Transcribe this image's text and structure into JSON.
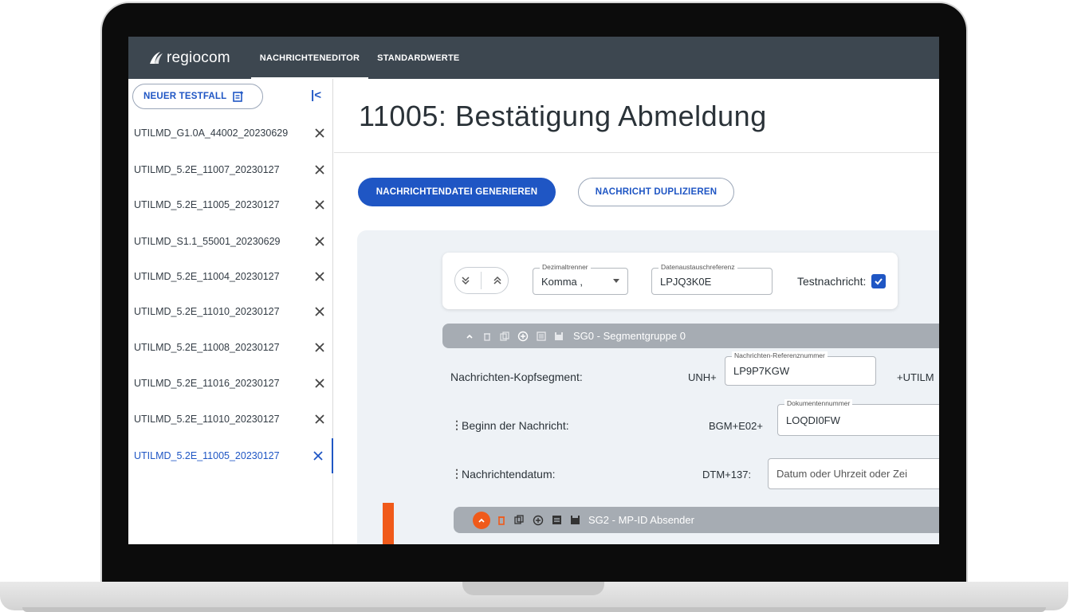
{
  "app": {
    "brand": "regiocom",
    "nav_tabs": [
      {
        "label": "NACHRICHTENEDITOR",
        "active": true
      },
      {
        "label": "STANDARDWERTE",
        "active": false
      }
    ]
  },
  "sidebar": {
    "new_case_label": "NEUER TESTFALL",
    "collapse_icon": "|<",
    "cases": [
      {
        "label": "UTILMD_G1.0A_44002_20230629",
        "active": false
      },
      {
        "label": "UTILMD_5.2E_11007_20230127",
        "active": false
      },
      {
        "label": "UTILMD_5.2E_11005_20230127",
        "active": false
      },
      {
        "label": "UTILMD_S1.1_55001_20230629",
        "active": false
      },
      {
        "label": "UTILMD_5.2E_11004_20230127",
        "active": false
      },
      {
        "label": "UTILMD_5.2E_11010_20230127",
        "active": false
      },
      {
        "label": "UTILMD_5.2E_11008_20230127",
        "active": false
      },
      {
        "label": "UTILMD_5.2E_11016_20230127",
        "active": false
      },
      {
        "label": "UTILMD_5.2E_11010_20230127",
        "active": false
      },
      {
        "label": "UTILMD_5.2E_11005_20230127",
        "active": true
      }
    ]
  },
  "main": {
    "title": "11005: Bestätigung Abmeldung",
    "generate_button": "NACHRICHTENDATEI GENERIEREN",
    "duplicate_button": "NACHRICHT DUPLIZIEREN",
    "settings": {
      "dezimal_label": "Dezimaltrenner",
      "dezimal_value": "Komma ,",
      "daten_label": "Datenaustauschreferenz",
      "daten_value": "LPJQ3K0E",
      "testnachricht_label": "Testnachricht:",
      "testnachricht_checked": true
    },
    "segment_group_0": {
      "title": "SG0 - Segmentgruppe 0",
      "rows": {
        "kopf_label": "Nachrichten-Kopfsegment:",
        "kopf_prefix": "UNH+",
        "kopf_field_label": "Nachrichten-Referenznummer",
        "kopf_field_value": "LP9P7KGW",
        "kopf_suffix": "+UTILM",
        "beginn_label": "Beginn der Nachricht:",
        "beginn_prefix": "BGM+E02+",
        "beginn_field_label": "Dokumentennummer",
        "beginn_field_value": "LOQDI0FW",
        "datum_label": "Nachrichtendatum:",
        "datum_prefix": "DTM+137:",
        "datum_placeholder": "Datum oder Uhrzeit oder Zei"
      }
    },
    "segment_group_2": {
      "title": "SG2 - MP-ID Absender"
    }
  },
  "colors": {
    "topbar": "#3d4750",
    "primary": "#1f56c4",
    "accent_orange": "#f05a1a",
    "segment_bar": "#a6acb3",
    "workspace": "#eef2f6"
  }
}
